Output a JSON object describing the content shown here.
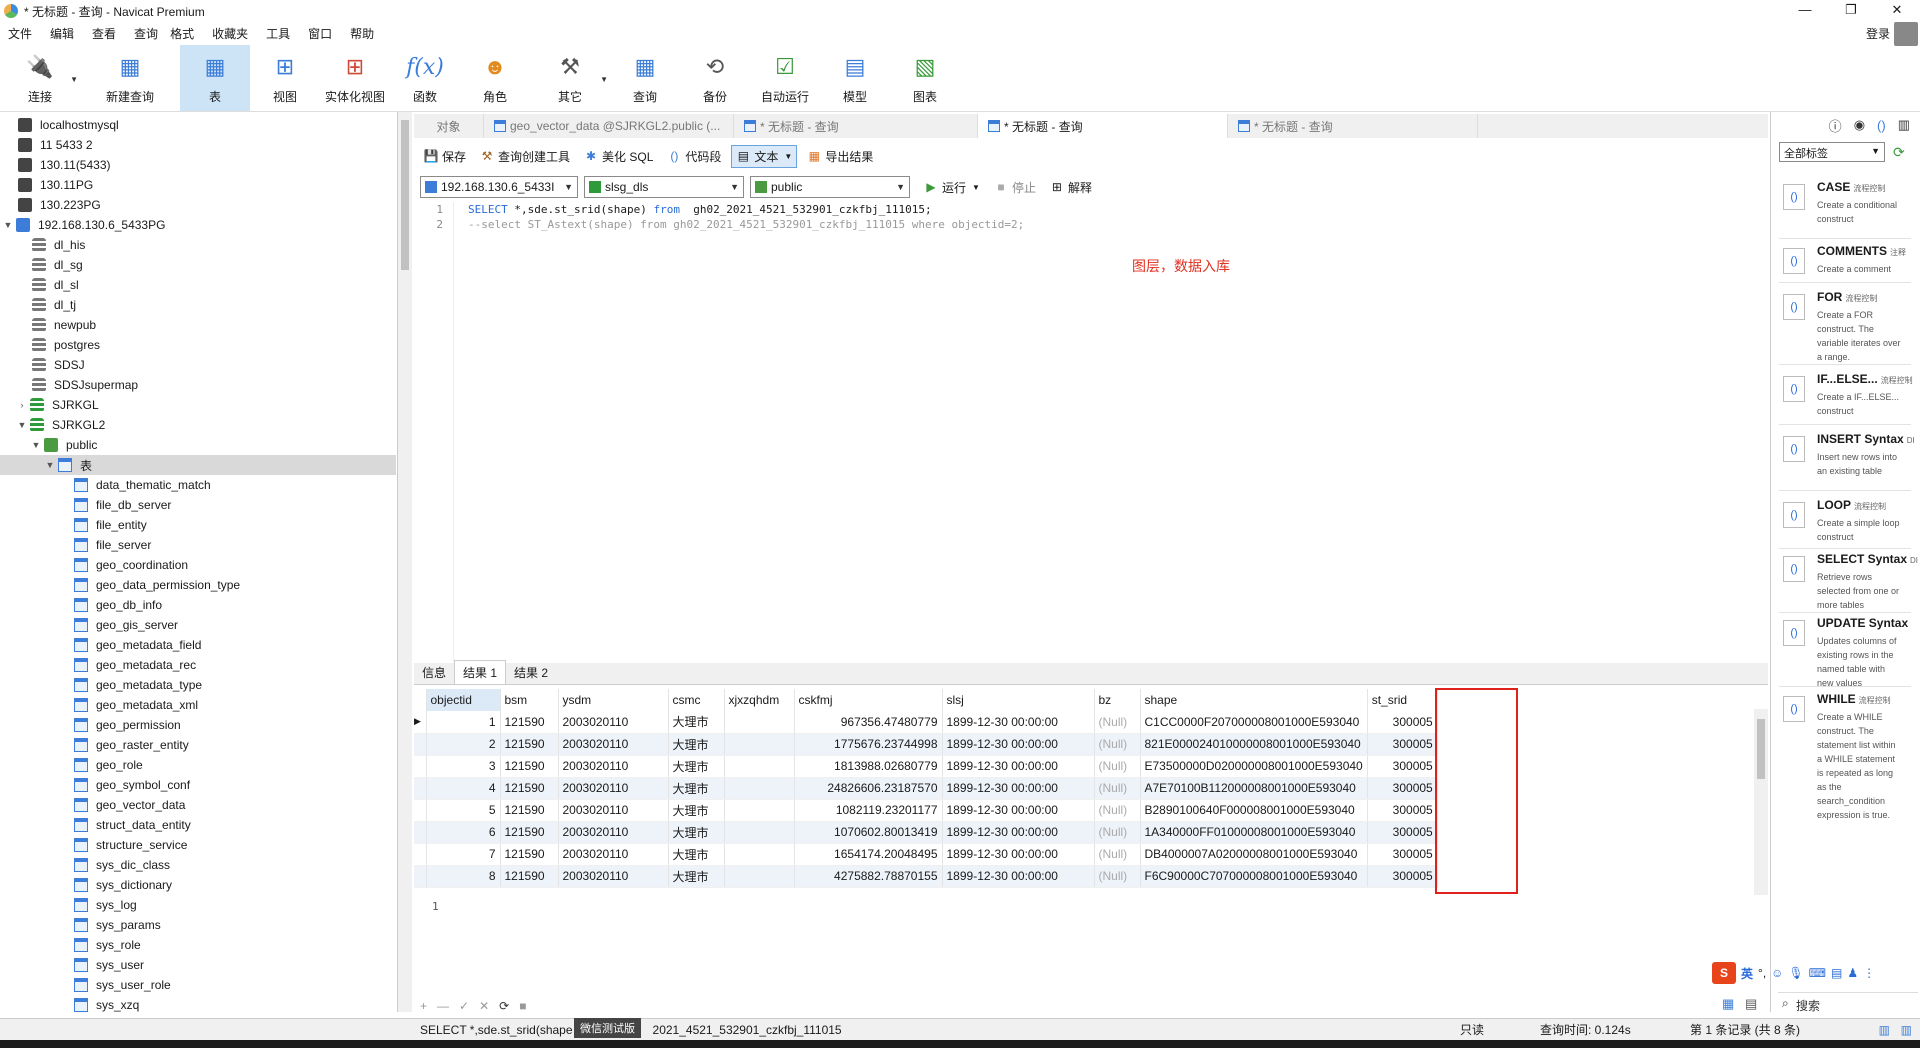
{
  "window": {
    "title": "* 无标题 - 查询 - Navicat Premium",
    "controls": [
      "—",
      "❐",
      "✕"
    ]
  },
  "menu": [
    "文件",
    "编辑",
    "查看",
    "查询",
    "格式",
    "收藏夹",
    "工具",
    "窗口",
    "帮助"
  ],
  "login": "登录",
  "toolbar": [
    {
      "label": "连接",
      "icon": "plug-icon"
    },
    {
      "label": "新建查询",
      "icon": "new-query-icon"
    },
    {
      "label": "表",
      "icon": "table-icon"
    },
    {
      "label": "视图",
      "icon": "view-icon"
    },
    {
      "label": "实体化视图",
      "icon": "materialized-view-icon"
    },
    {
      "label": "函数",
      "icon": "function-icon"
    },
    {
      "label": "角色",
      "icon": "role-icon"
    },
    {
      "label": "其它",
      "icon": "other-icon"
    },
    {
      "label": "查询",
      "icon": "query-icon"
    },
    {
      "label": "备份",
      "icon": "backup-icon"
    },
    {
      "label": "自动运行",
      "icon": "auto-run-icon"
    },
    {
      "label": "模型",
      "icon": "model-icon"
    },
    {
      "label": "图表",
      "icon": "chart-icon"
    }
  ],
  "tree": {
    "connections": [
      "localhostmysql",
      "11 5433 2",
      "130.11(5433)",
      "130.11PG",
      "130.223PG",
      "192.168.130.6_5433PG"
    ],
    "databases": [
      "dl_his",
      "dl_sg",
      "dl_sl",
      "dl_tj",
      "newpub",
      "postgres",
      "SDSJ",
      "SDSJsupermap",
      "SJRKGL",
      "SJRKGL2"
    ],
    "schema": "public",
    "tables_node": "表",
    "tables": [
      "data_thematic_match",
      "file_db_server",
      "file_entity",
      "file_server",
      "geo_coordination",
      "geo_data_permission_type",
      "geo_db_info",
      "geo_gis_server",
      "geo_metadata_field",
      "geo_metadata_rec",
      "geo_metadata_type",
      "geo_metadata_xml",
      "geo_permission",
      "geo_raster_entity",
      "geo_role",
      "geo_symbol_conf",
      "geo_vector_data",
      "struct_data_entity",
      "structure_service",
      "sys_dic_class",
      "sys_dictionary",
      "sys_log",
      "sys_params",
      "sys_role",
      "sys_user",
      "sys_user_role",
      "sys_xzq"
    ]
  },
  "tabs": [
    "对象",
    "geo_vector_data @SJRKGL2.public (...",
    "* 无标题 - 查询",
    "* 无标题 - 查询",
    "* 无标题 - 查询"
  ],
  "qtoolbar": {
    "save": "保存",
    "builder": "查询创建工具",
    "beautify": "美化 SQL",
    "snippet": "代码段",
    "text": "文本",
    "export": "导出结果",
    "run": "运行",
    "stop": "停止",
    "explain": "解释"
  },
  "selectors": {
    "connection": "192.168.130.6_5433I",
    "database": "slsg_dls",
    "schema": "public"
  },
  "editor": {
    "line_numbers": [
      "1",
      "2"
    ],
    "line1_kw1": "SELECT",
    "line1_mid": " *,sde.st_srid(shape) ",
    "line1_kw2": "from",
    "line1_rest": "  gh02_2021_4521_532901_czkfbj_111015;",
    "line2": "--select ST_Astext(shape) from gh02_2021_4521_532901_czkfbj_111015 where objectid=2;",
    "annotation": "图层，数据入库"
  },
  "result_tabs": [
    "信息",
    "结果 1",
    "结果 2"
  ],
  "grid": {
    "columns": [
      "objectid",
      "bsm",
      "ysdm",
      "csmc",
      "xjxzqhdm",
      "cskfmj",
      "slsj",
      "bz",
      "shape",
      "st_srid"
    ],
    "rows": [
      [
        "1",
        "121590",
        "2003020110",
        "大理市",
        "",
        "967356.47480779",
        "1899-12-30 00:00:00",
        "(Null)",
        "C1CC0000F207000008001000E593040",
        "300005"
      ],
      [
        "2",
        "121590",
        "2003020110",
        "大理市",
        "",
        "1775676.23744998",
        "1899-12-30 00:00:00",
        "(Null)",
        "821E000024010000008001000E593040",
        "300005"
      ],
      [
        "3",
        "121590",
        "2003020110",
        "大理市",
        "",
        "1813988.02680779",
        "1899-12-30 00:00:00",
        "(Null)",
        "E73500000D020000008001000E593040",
        "300005"
      ],
      [
        "4",
        "121590",
        "2003020110",
        "大理市",
        "",
        "24826606.23187570",
        "1899-12-30 00:00:00",
        "(Null)",
        "A7E70100B112000008001000E593040",
        "300005"
      ],
      [
        "5",
        "121590",
        "2003020110",
        "大理市",
        "",
        "1082119.23201177",
        "1899-12-30 00:00:00",
        "(Null)",
        "B2890100640F000008001000E593040",
        "300005"
      ],
      [
        "6",
        "121590",
        "2003020110",
        "大理市",
        "",
        "1070602.80013419",
        "1899-12-30 00:00:00",
        "(Null)",
        "1A340000FF01000008001000E593040",
        "300005"
      ],
      [
        "7",
        "121590",
        "2003020110",
        "大理市",
        "",
        "1654174.20048495",
        "1899-12-30 00:00:00",
        "(Null)",
        "DB4000007A02000008001000E593040",
        "300005"
      ],
      [
        "8",
        "121590",
        "2003020110",
        "大理市",
        "",
        "4275882.78870155",
        "1899-12-30 00:00:00",
        "(Null)",
        "F6C90000C707000008001000E593040",
        "300005"
      ]
    ]
  },
  "bottom_line": "1",
  "actionbar": [
    "+",
    "—",
    "✓",
    "✕",
    "⟳",
    "■"
  ],
  "status": {
    "sql": "SELECT *,sde.st_srid(shape",
    "sql_tail": "2021_4521_532901_czkfbj_111015",
    "wx_tip": "微信测试版",
    "readonly": "只读",
    "time": "查询时间: 0.124s",
    "records": "第 1 条记录 (共 8 条)"
  },
  "right_panel": {
    "filter": "全部标签",
    "snippets": [
      {
        "title": "CASE",
        "tag": "流程控制",
        "desc": "Create a conditional construct"
      },
      {
        "title": "COMMENTS",
        "tag": "注释",
        "desc": "Create a comment"
      },
      {
        "title": "FOR",
        "tag": "流程控制",
        "desc": "Create a FOR construct. The variable iterates over a range."
      },
      {
        "title": "IF...ELSE...",
        "tag": "流程控制",
        "desc": "Create a IF...ELSE... construct"
      },
      {
        "title": "INSERT Syntax",
        "tag": "DI",
        "desc": "Insert new rows into an existing table"
      },
      {
        "title": "LOOP",
        "tag": "流程控制",
        "desc": "Create a simple loop construct"
      },
      {
        "title": "SELECT Syntax",
        "tag": "DI",
        "desc": "Retrieve rows selected from one or more tables"
      },
      {
        "title": "UPDATE Syntax",
        "tag": "",
        "desc": "Updates columns of existing rows in the named table with new values"
      },
      {
        "title": "WHILE",
        "tag": "流程控制",
        "desc": "Create a WHILE construct. The statement list within a WHILE statement is repeated as long as the search_condition expression is true."
      }
    ],
    "search": "搜索",
    "ime_label": "英"
  }
}
